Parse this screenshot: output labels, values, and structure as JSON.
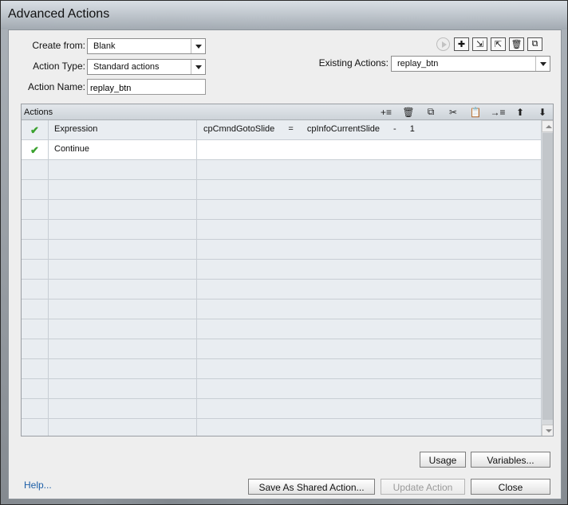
{
  "window": {
    "title": "Advanced Actions"
  },
  "form": {
    "create_from_label": "Create from:",
    "create_from_value": "Blank",
    "action_type_label": "Action Type:",
    "action_type_value": "Standard actions",
    "action_name_label": "Action Name:",
    "action_name_value": "replay_btn",
    "existing_actions_label": "Existing Actions:",
    "existing_actions_value": "replay_btn"
  },
  "top_toolbar": {
    "icons": [
      "preview-play-icon",
      "add-action-icon",
      "import-action-icon",
      "export-action-icon",
      "delete-action-icon",
      "duplicate-action-icon"
    ]
  },
  "actions_panel": {
    "title": "Actions",
    "toolbar_icons": [
      "insert-row-icon",
      "delete-row-icon",
      "copy-row-icon",
      "cut-row-icon",
      "paste-row-icon",
      "indent-row-icon",
      "move-up-icon",
      "move-down-icon"
    ],
    "rows": [
      {
        "checked": true,
        "action": "Expression",
        "expr": [
          "cpCmndGotoSlide",
          "=",
          "cpInfoCurrentSlide",
          "-",
          "1"
        ]
      },
      {
        "checked": true,
        "action": "Continue",
        "expr": []
      }
    ],
    "empty_rows": 14
  },
  "buttons": {
    "usage": "Usage",
    "variables": "Variables...",
    "save_shared": "Save As Shared Action...",
    "update": "Update Action",
    "close": "Close"
  },
  "help_link": "Help..."
}
